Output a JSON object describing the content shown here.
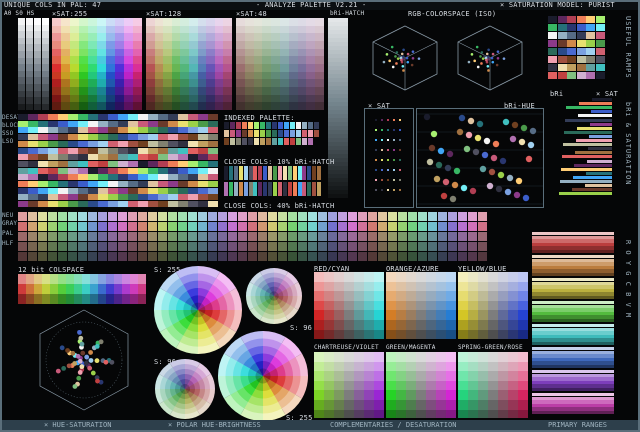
{
  "header": {
    "unique_cols": "UNIQUE COLS IN PAL: 47",
    "title": "- ANALYZE PALETTE V2.21 -",
    "sat_model": "× SATURATION MODEL: PURIST"
  },
  "labels": {
    "abs": "A0 S0 HS",
    "sat255": "×SAT:255",
    "sat128": "×SAT:128",
    "sat48": "×SAT:48",
    "bri_hatch_top": "bRi-HATCH",
    "rgb_colorspace": "RGB-COLORSPACE (ISO)",
    "x_sat": "× SAT",
    "bri_hue": "bRi-HUE",
    "bri": "bRi",
    "sat_r": "× SAT",
    "indexed_palette": "INDEXED PALETTE:",
    "close_cols_1": "CLOSE COLS: 10% bRi-HATCH",
    "close_cols_2": "CLOSE COLS: 40% bRi-HATCH",
    "bit12": "12 bit COLSPACE",
    "s255_a": "S: 255",
    "s96_a": "S: 96",
    "s96_b": "S: 96",
    "s255_b": "S: 255",
    "red_cyan": "RED/CYAN",
    "orange_azure": "ORANGE/AZURE",
    "yellow_blue": "YELLOW/BLUE",
    "chart_violet": "CHARTREUSE/VIOLET",
    "green_magenta": "GREEN/MAGENTA",
    "spring_rose": "SPRING-GREEN/ROSE",
    "left_side": [
      "DESAT",
      "bLOCK",
      "SSO",
      "LSO",
      "NEU",
      "GRAY",
      "PAL",
      "HLF"
    ]
  },
  "side": {
    "useful_ramps": "USEFUL RAMPS",
    "bri_saturation": "bRi & SATURATION",
    "ramp_letters": "R O Y G C B V M"
  },
  "footer": {
    "hue_sat": "× HUE-SATURATION",
    "polar": "× POLAR HUE-BRIGHTNESS",
    "complementaries": "COMPLEMENTARIES / DESATURATION",
    "primary_ranges": "PRIMARY RANGES"
  },
  "colors": {
    "frame": "#5a6e7a",
    "footer": "#2d3f4b",
    "text": "#d8dde3"
  },
  "palette": [
    "#1a1c2c",
    "#5d275d",
    "#b13e53",
    "#ef7d57",
    "#ffcd75",
    "#a7f070",
    "#38b764",
    "#257179",
    "#29366f",
    "#3b5dc9",
    "#41a6f6",
    "#73eff7",
    "#f4f4f4",
    "#94b0c2",
    "#566c86",
    "#333c57",
    "#e0c3a0",
    "#c85a7a",
    "#8c3a8a",
    "#6a3a2a",
    "#d08a4a",
    "#e8e070",
    "#9ad04a",
    "#4a9a4a",
    "#2a6a5a",
    "#2a4a8a",
    "#4a6ad0",
    "#7aa0e0",
    "#a0d0f0",
    "#d06070",
    "#f0a0b0",
    "#a05040",
    "#704020",
    "#c0c0a0",
    "#808070",
    "#505060",
    "#303040",
    "#f0e0b0",
    "#c0a060",
    "#a07040",
    "#60a0a0",
    "#40c0c0",
    "#e06060",
    "#c04040",
    "#80c080",
    "#d0b0d0",
    "#b070b0"
  ]
}
